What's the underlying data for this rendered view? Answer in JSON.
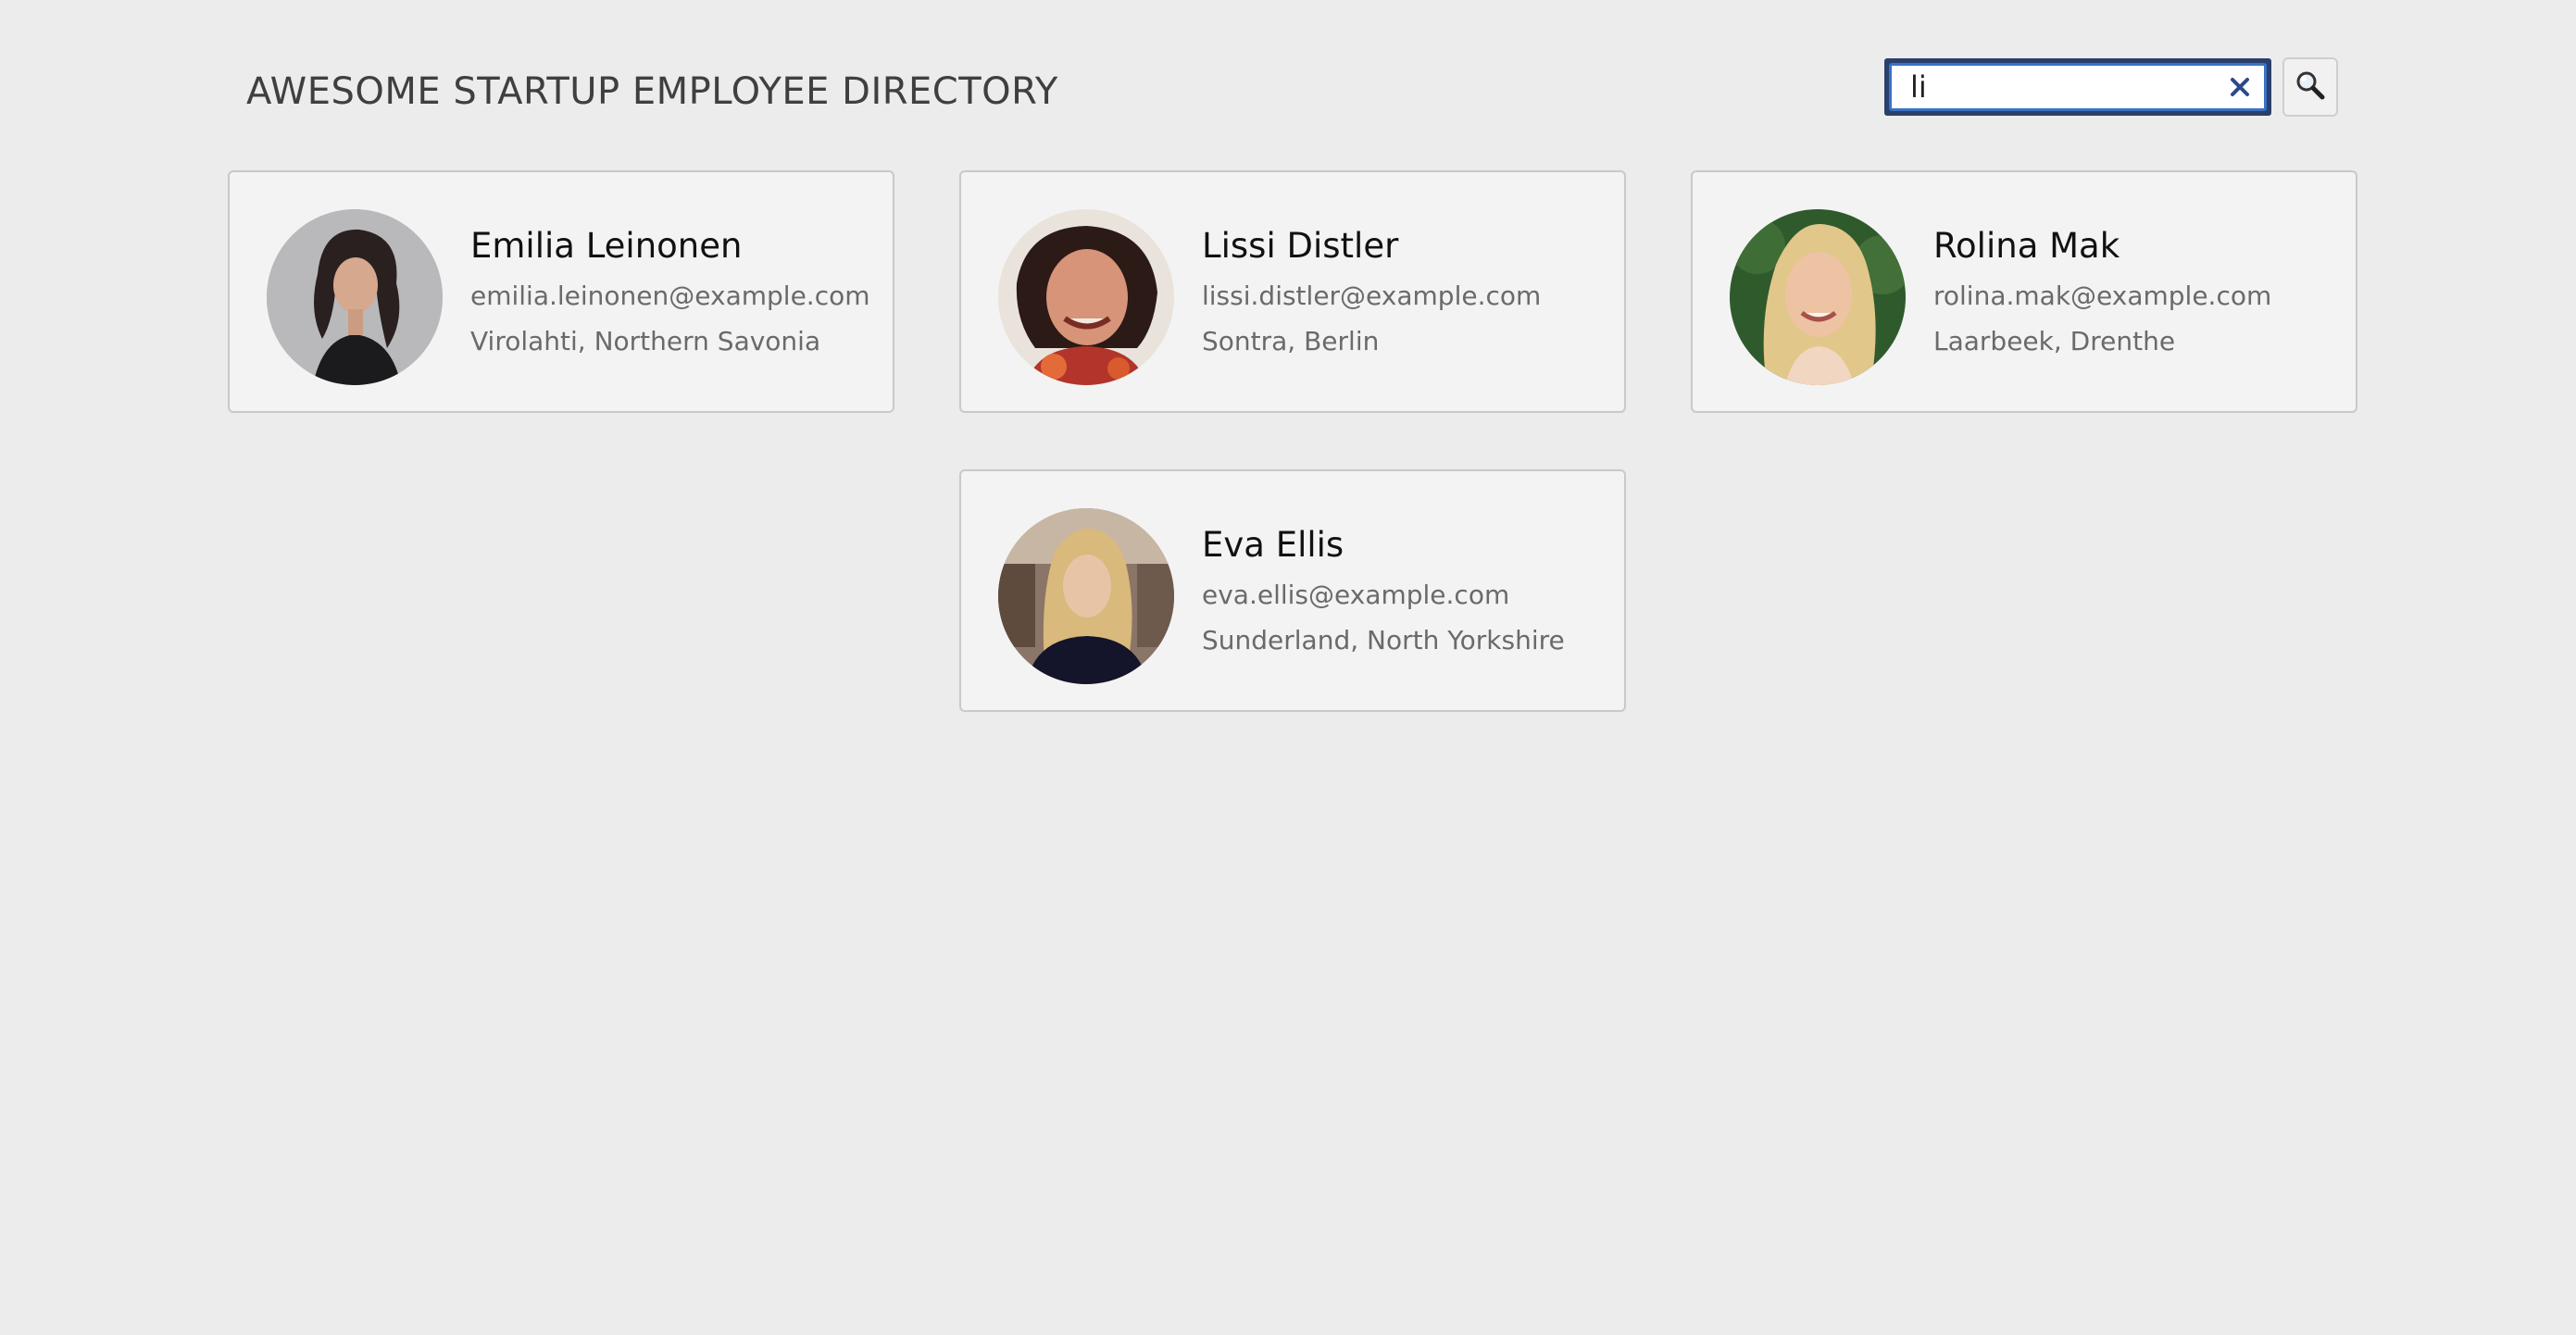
{
  "header": {
    "title": "AWESOME STARTUP EMPLOYEE DIRECTORY"
  },
  "search": {
    "value": "li",
    "clear_icon": "close-icon",
    "button_icon": "search-icon"
  },
  "colors": {
    "background": "#ececec",
    "card_background": "#f3f3f3",
    "search_border": "#2a3f6b",
    "clear_icon": "#2a4a8a"
  },
  "employees": [
    {
      "name": "Emilia Leinonen",
      "email": "emilia.leinonen@example.com",
      "location": "Virolahti, Northern Savonia"
    },
    {
      "name": "Lissi Distler",
      "email": "lissi.distler@example.com",
      "location": "Sontra, Berlin"
    },
    {
      "name": "Rolina Mak",
      "email": "rolina.mak@example.com",
      "location": "Laarbeek, Drenthe"
    },
    {
      "name": "Eva Ellis",
      "email": "eva.ellis@example.com",
      "location": "Sunderland, North Yorkshire"
    }
  ]
}
